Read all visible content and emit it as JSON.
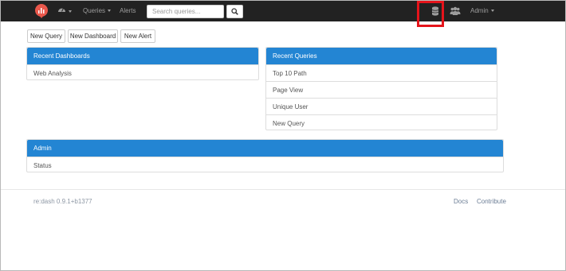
{
  "nav": {
    "queries_label": "Queries",
    "alerts_label": "Alerts",
    "search_placeholder": "Search queries...",
    "admin_label": "Admin",
    "brand_color": "#e9574b",
    "navbar_color": "#222222"
  },
  "toolbar": {
    "new_query": "New Query",
    "new_dashboard": "New Dashboard",
    "new_alert": "New Alert"
  },
  "recent_dashboards": {
    "title": "Recent Dashboards",
    "items": [
      "Web Analysis"
    ]
  },
  "recent_queries": {
    "title": "Recent Queries",
    "items": [
      "Top 10 Path",
      "Page View",
      "Unique User",
      "New Query"
    ]
  },
  "admin_panel": {
    "title": "Admin",
    "items": [
      "Status"
    ]
  },
  "footer": {
    "version": "re:dash 0.9.1+b1377",
    "docs": "Docs",
    "contribute": "Contribute"
  },
  "colors": {
    "panel_header": "#2385d3",
    "highlight": "#e5141b"
  }
}
